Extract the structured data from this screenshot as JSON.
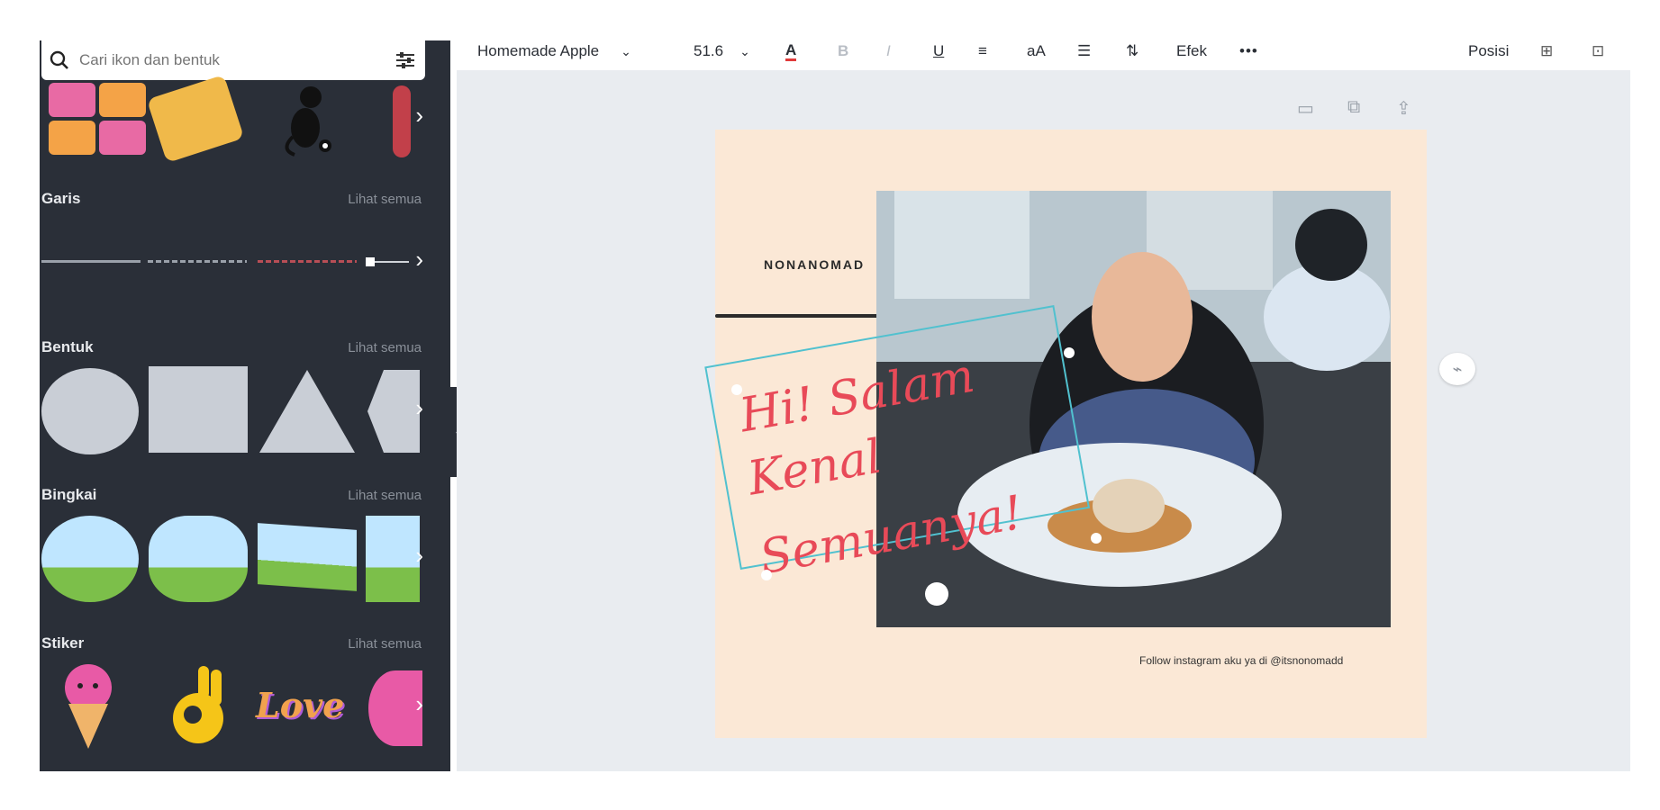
{
  "sidebar": {
    "search_placeholder": "Cari ikon dan bentuk",
    "sections": [
      {
        "title": "Garis",
        "see_all": "Lihat semua"
      },
      {
        "title": "Bentuk",
        "see_all": "Lihat semua"
      },
      {
        "title": "Bingkai",
        "see_all": "Lihat semua"
      },
      {
        "title": "Stiker",
        "see_all": "Lihat semua"
      }
    ],
    "sticker_love_text": "Love"
  },
  "toolbar": {
    "font_name": "Homemade Apple",
    "font_size": "51.6",
    "text_case": "aA",
    "effects": "Efek",
    "more": "•••",
    "position": "Posisi"
  },
  "canvas": {
    "brand_text": "NONANOMAD",
    "hand_line1": "Hi! Salam",
    "hand_line2": "Kenal",
    "hand_line3": "Semuanya!",
    "follow_text": "Follow instagram aku ya di @itsnonomadd"
  },
  "colors": {
    "sidebar_bg": "#2a2f38",
    "canvas_bg": "#fbe8d6",
    "accent_red": "#e84a58",
    "selection": "#51c1cf"
  }
}
